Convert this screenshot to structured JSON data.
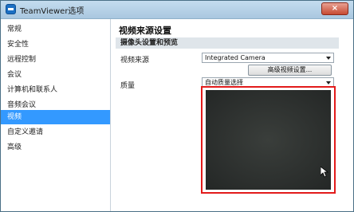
{
  "window": {
    "title": "TeamViewer选项",
    "close_label": "×"
  },
  "sidebar": {
    "items": [
      {
        "label": "常规"
      },
      {
        "label": "安全性"
      },
      {
        "label": "远程控制"
      },
      {
        "label": "会议"
      },
      {
        "label": "计算机和联系人"
      },
      {
        "label": "音频会议"
      },
      {
        "label": "视频",
        "active": true
      },
      {
        "label": "自定义邀请"
      },
      {
        "label": "高级"
      }
    ]
  },
  "content": {
    "heading": "视频来源设置",
    "section_title": "摄像头设置和预览",
    "video_source_label": "视频来源",
    "video_source_value": "Integrated Camera",
    "advanced_button_label": "高级视频设置...",
    "quality_label": "质量",
    "quality_value": "自动质量选择"
  },
  "colors": {
    "active_nav": "#3399ff",
    "highlight_frame": "#e21b1b",
    "preview_bg": "#2f3230"
  },
  "icons": {
    "app": "teamviewer-logo-icon",
    "cursor": "mouse-pointer-icon"
  }
}
